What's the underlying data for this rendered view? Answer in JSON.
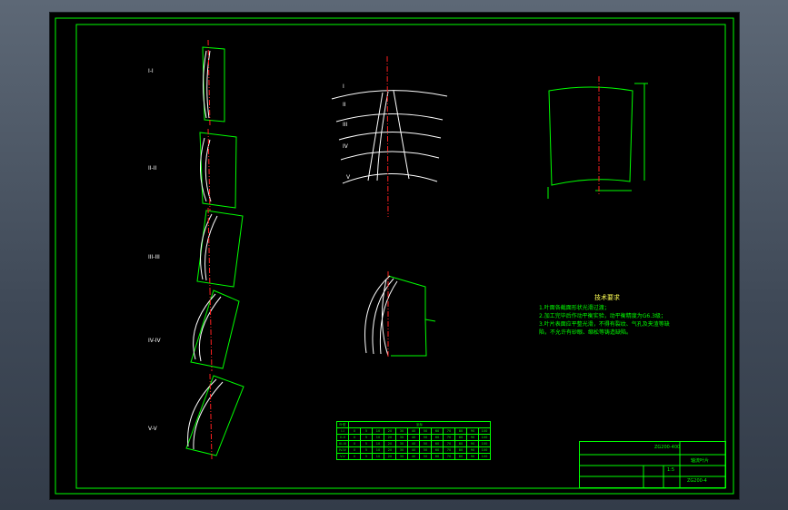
{
  "sections": [
    "I-I",
    "II-II",
    "III-III",
    "IV-IV",
    "V-V"
  ],
  "plan_labels": [
    "I",
    "II",
    "III",
    "IV",
    "V"
  ],
  "notes": {
    "title": "技术要求",
    "items": [
      "1.叶面各截面形状光滑过渡；",
      "2.加工完毕后作动平衡实验，动平衡精度为G6.3级；",
      "3.叶片表面应平整光滑，不得有裂纹、气孔及夹渣等缺陷，不允许有砂眼、缩松等铸造缺陷。"
    ]
  },
  "table": {
    "header": [
      "叶型",
      "坐标"
    ],
    "rows": [
      [
        "I-I",
        "0",
        "5",
        "10",
        "20",
        "30",
        "40",
        "50",
        "60",
        "70",
        "80",
        "90",
        "100"
      ],
      [
        "II-II",
        "0",
        "5",
        "10",
        "20",
        "30",
        "40",
        "50",
        "60",
        "70",
        "80",
        "90",
        "100"
      ],
      [
        "III-III",
        "0",
        "5",
        "10",
        "20",
        "30",
        "40",
        "50",
        "60",
        "70",
        "80",
        "90",
        "100"
      ],
      [
        "IV-IV",
        "0",
        "5",
        "10",
        "20",
        "30",
        "40",
        "50",
        "60",
        "70",
        "80",
        "90",
        "100"
      ],
      [
        "V-V",
        "0",
        "5",
        "10",
        "20",
        "30",
        "40",
        "50",
        "60",
        "70",
        "80",
        "90",
        "100"
      ]
    ]
  },
  "title_block": {
    "code": "ZG200-400",
    "name": "轴流叶片",
    "drawing_no": "ZG200-4",
    "ratio": "1:5"
  }
}
